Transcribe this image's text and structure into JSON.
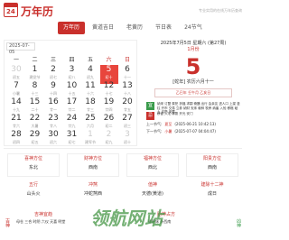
{
  "brand": {
    "logo_text": "24",
    "name": "万年历",
    "slogan": "专业实用的在线万年历查询"
  },
  "nav": [
    "万年历",
    "黄道吉日",
    "老黄历",
    "节日表",
    "24节气"
  ],
  "calendar": {
    "date_input": "2025-07-05",
    "weekdays": [
      "一",
      "二",
      "三",
      "四",
      "五",
      "六",
      "日"
    ],
    "rows": [
      [
        {
          "d": "30",
          "l": "初五",
          "o": true
        },
        {
          "d": "1",
          "l": "建党节"
        },
        {
          "d": "2",
          "l": "初七"
        },
        {
          "d": "3",
          "l": "初八"
        },
        {
          "d": "4",
          "l": "初九"
        },
        {
          "d": "5",
          "l": "初十",
          "t": true
        },
        {
          "d": "6",
          "l": "十一"
        }
      ],
      [
        {
          "d": "7",
          "l": "小暑"
        },
        {
          "d": "8",
          "l": "十三"
        },
        {
          "d": "9",
          "l": "十四"
        },
        {
          "d": "10",
          "l": "十五"
        },
        {
          "d": "11",
          "l": "十六"
        },
        {
          "d": "12",
          "l": "十七"
        },
        {
          "d": "13",
          "l": "十八"
        }
      ],
      [
        {
          "d": "14",
          "l": "十九"
        },
        {
          "d": "15",
          "l": "二十"
        },
        {
          "d": "16",
          "l": "廿一"
        },
        {
          "d": "17",
          "l": "廿二"
        },
        {
          "d": "18",
          "l": "廿三"
        },
        {
          "d": "19",
          "l": "廿四"
        },
        {
          "d": "20",
          "l": "廿五"
        }
      ],
      [
        {
          "d": "21",
          "l": "廿六"
        },
        {
          "d": "22",
          "l": "大暑"
        },
        {
          "d": "23",
          "l": "廿八"
        },
        {
          "d": "24",
          "l": "廿九"
        },
        {
          "d": "25",
          "l": "六月"
        },
        {
          "d": "26",
          "l": "初二"
        },
        {
          "d": "27",
          "l": "初三"
        }
      ],
      [
        {
          "d": "28",
          "l": "初四"
        },
        {
          "d": "29",
          "l": "初五"
        },
        {
          "d": "30",
          "l": "初六"
        },
        {
          "d": "31",
          "l": "初七"
        },
        {
          "d": "1",
          "l": "建军节",
          "o": true
        },
        {
          "d": "2",
          "l": "初九",
          "o": true
        },
        {
          "d": "3",
          "l": "初十",
          "o": true
        }
      ]
    ]
  },
  "detail": {
    "header": "2025年7月5日 星期六 (第27周)",
    "sub": "1月份",
    "big_day": "5",
    "lunar": "[蛇年] 农历六月十一",
    "ganzhi": "乙巳年 壬午月 乙亥日",
    "yi_label": "宜",
    "yi_text": "纳采 订盟 祭祀 祈福 求嗣 斋醮 出行 会亲友 进人口 上梁 竖柱 开市 交易 立券 纳财 安床 栽种 牧养 纳畜 入殓 移柩 破土 启攒 安葬",
    "ji_label": "忌",
    "ji_text": "移徙 入宅 嫁娶 开光 安门",
    "jieqi": [
      {
        "label": "上一节气:",
        "name": "夏至",
        "date": "(2025-06-21 10:42:13)"
      },
      {
        "label": "下一节气:",
        "name": "小暑",
        "date": "(2025-07-07 04:04:47)"
      }
    ]
  },
  "luck": [
    {
      "title": "喜神方位",
      "value": "东北"
    },
    {
      "title": "财神方位",
      "value": "西南"
    },
    {
      "title": "福神方位",
      "value": "西北"
    },
    {
      "title": "阳贵方位",
      "value": "西南"
    }
  ],
  "row3": [
    {
      "title": "五行",
      "value": "山头火"
    },
    {
      "title": "冲煞",
      "value": "冲蛇煞西"
    },
    {
      "title": "值神",
      "value": "天德(黄道)"
    },
    {
      "title": "建除十二神",
      "value": "成日"
    }
  ],
  "bottom": {
    "left_side": "吉神",
    "right_side": "凶神",
    "left_title": "吉神宜趋",
    "left_text": "母仓 三合 时阴 六仪 天喜 明堂",
    "right_title": "胎神占方",
    "right_text": "碓磨床 外西南"
  },
  "watermark": "领航网站"
}
